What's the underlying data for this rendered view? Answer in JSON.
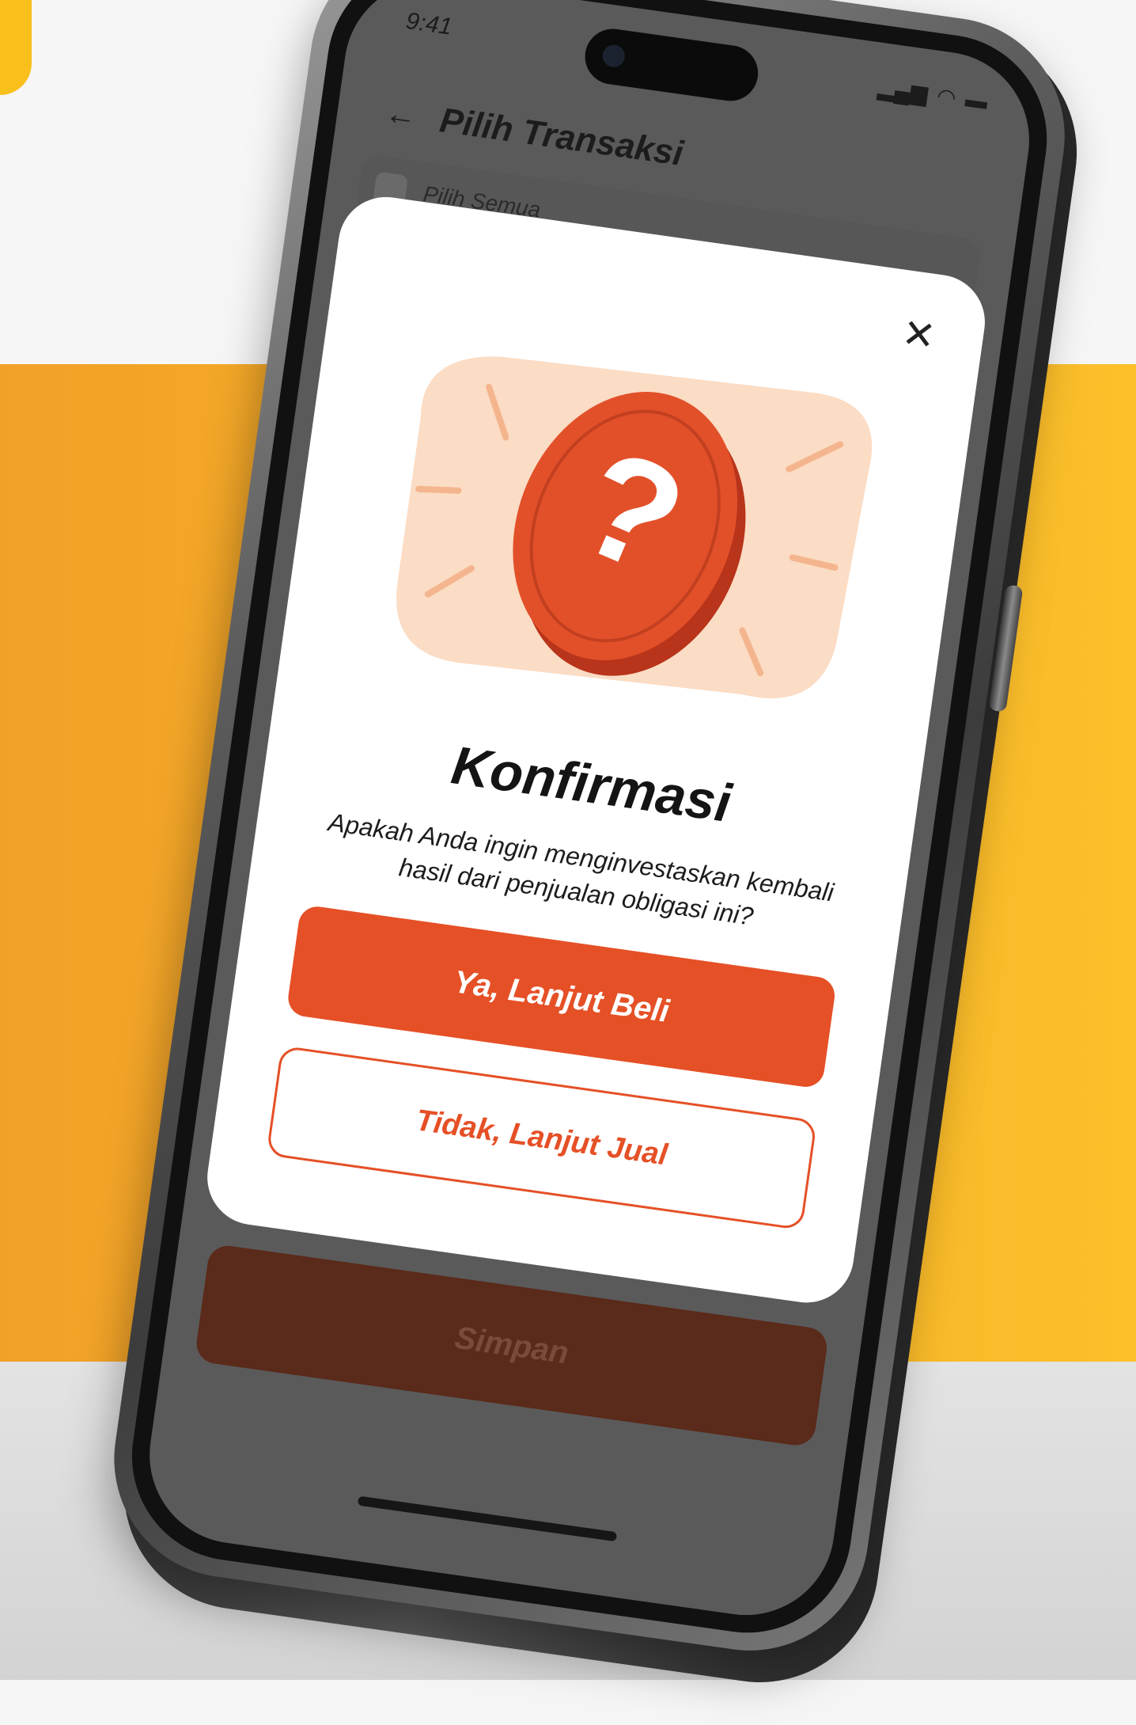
{
  "status_bar": {
    "time": "9:41",
    "signal_icon": "signal-icon",
    "wifi_icon": "wifi-icon",
    "battery_icon": "battery-icon"
  },
  "header": {
    "back_icon": "back-arrow-icon",
    "title": "Pilih Transaksi"
  },
  "list": {
    "select_all_label": "Pilih Semua"
  },
  "footer": {
    "save_label": "Simpan"
  },
  "modal": {
    "close_icon": "close-icon",
    "illustration": "question-coin-icon",
    "title": "Konfirmasi",
    "message": "Apakah Anda ingin menginvestaskan kembali hasil dari penjualan obligasi ini?",
    "primary_label": "Ya, Lanjut Beli",
    "secondary_label": "Tidak, Lanjut Jual"
  },
  "colors": {
    "accent": "#e55026",
    "background_orange": "#f6b128",
    "background_yellow": "#f9bf1b",
    "coin_red": "#e2502a",
    "illustration_peach": "#fbdcc4"
  }
}
